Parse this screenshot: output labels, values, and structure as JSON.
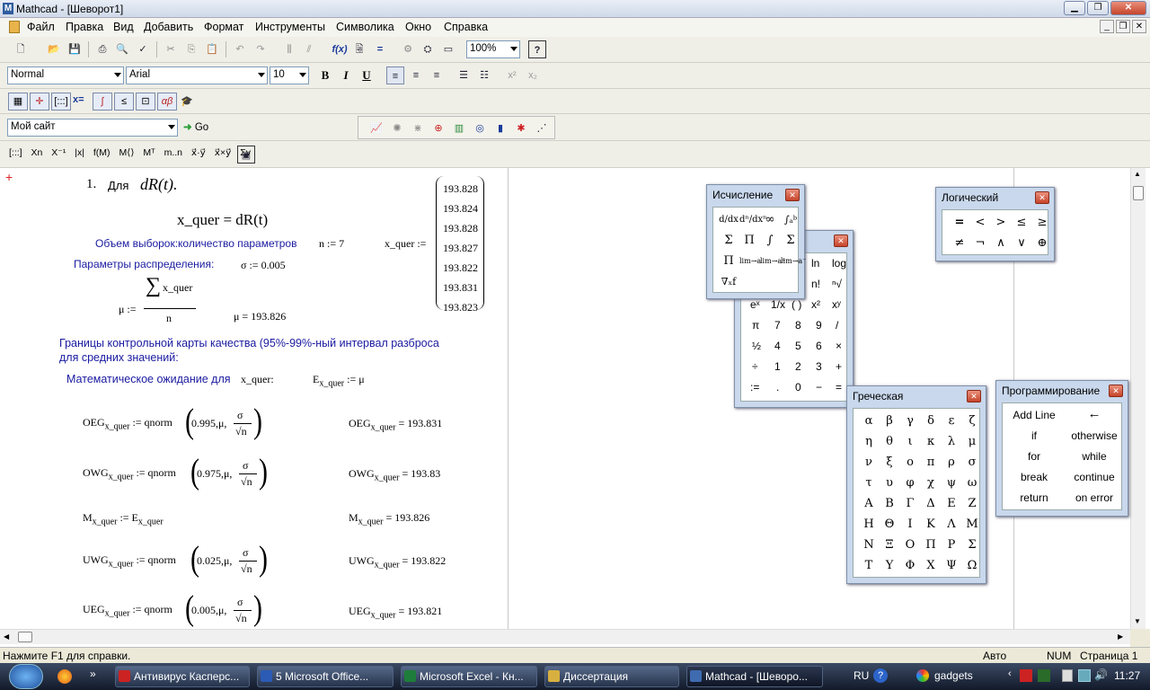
{
  "window": {
    "title": "Mathcad - [Шеворот1]"
  },
  "menu": [
    "Файл",
    "Правка",
    "Вид",
    "Добавить",
    "Формат",
    "Инструменты",
    "Символика",
    "Окно",
    "Справка"
  ],
  "toolbar": {
    "zoom": "100%",
    "style": "Normal",
    "font": "Arial",
    "size": "10",
    "bold": "B",
    "italic": "I",
    "underline": "U",
    "url": "Мой сайт",
    "go": "Go"
  },
  "math_toolbar": [
    "x=",
    "[:::]",
    "∫",
    "≤",
    "αβ"
  ],
  "matrix_toolbar": [
    "[:::]",
    "Xn",
    "X⁻¹",
    "|x|",
    "f(M)",
    "M⟨⟩",
    "Mᵀ",
    "m..n",
    "x⃗·y⃗",
    "x⃗×y⃗",
    "Σv"
  ],
  "doc": {
    "step": "1.",
    "step_word": "Для",
    "step_expr": "dR(t).",
    "xquer_def": "x_quer = dR(t)",
    "sample_label": "Объем выборок:количество параметров",
    "n_def": "n := 7",
    "xquer_assign": "x_quer :=",
    "xquer_values": [
      "193.828",
      "193.824",
      "193.828",
      "193.827",
      "193.822",
      "193.831",
      "193.823"
    ],
    "dist_label": "Параметры распределения:",
    "sigma_def": "σ := 0.005",
    "mu_lhs": "μ :=",
    "sum_sym": "∑",
    "sum_arg": "x_quer",
    "mu_den": "n",
    "mu_result": "μ = 193.826",
    "limits_line1": "Границы контрольной карты качества (95%-99%-ный интервал разброса",
    "limits_line2": "для средних значений:",
    "expect_label": "Математическое ожидание для",
    "expect_var": "x_quer:",
    "E_def": "E",
    "E_sub": "x_quer",
    "E_rhs": ":= μ",
    "rows": [
      {
        "name": "OEG",
        "sub": "x_quer",
        "fn": ":= qnorm",
        "p": "0.995",
        "res": "= 193.831"
      },
      {
        "name": "OWG",
        "sub": "x_quer",
        "fn": ":= qnorm",
        "p": "0.975",
        "res": "= 193.83"
      },
      {
        "name": "UWG",
        "sub": "x_quer",
        "fn": ":= qnorm",
        "p": "0.025",
        "res": "= 193.822"
      },
      {
        "name": "UEG",
        "sub": "x_quer",
        "fn": ":= qnorm",
        "p": "0.005",
        "res": "= 193.821"
      }
    ],
    "fn_mu": ",μ,",
    "fn_num": "σ",
    "fn_den": "√n",
    "M_name": "M",
    "M_sub": "x_quer",
    "M_rhs": ":= E",
    "M_rhs_sub": "x_quer",
    "M_res": "= 193.826"
  },
  "panels": {
    "calculus": {
      "title": "Исчисление",
      "items": [
        "d/dx",
        "dⁿ/dxⁿ",
        "∞",
        "∫ₐᵇ",
        "Σ",
        "Π",
        "∫",
        "Σ",
        "Π",
        "lim→a",
        "lim→a⁺",
        "lim→a⁻",
        "∇ₓf"
      ]
    },
    "calculator": {
      "items": [
        "ln",
        "log",
        "n!",
        "ⁿ√",
        "eˣ",
        "1/x",
        "( )",
        "x²",
        "xʸ",
        "π",
        "7",
        "8",
        "9",
        "/",
        "½",
        "4",
        "5",
        "6",
        "×",
        "÷",
        "1",
        "2",
        "3",
        "+",
        ":=",
        ".",
        "0",
        "−",
        "="
      ]
    },
    "logic": {
      "title": "Логический",
      "items": [
        "=",
        "<",
        ">",
        "≤",
        "≥",
        "≠",
        "¬",
        "∧",
        "∨",
        "⊕"
      ]
    },
    "greek": {
      "title": "Греческая",
      "items": [
        "α",
        "β",
        "γ",
        "δ",
        "ε",
        "ζ",
        "η",
        "θ",
        "ι",
        "κ",
        "λ",
        "μ",
        "ν",
        "ξ",
        "ο",
        "π",
        "ρ",
        "σ",
        "τ",
        "υ",
        "φ",
        "χ",
        "ψ",
        "ω",
        "Α",
        "Β",
        "Γ",
        "Δ",
        "Ε",
        "Ζ",
        "Η",
        "Θ",
        "Ι",
        "Κ",
        "Λ",
        "Μ",
        "Ν",
        "Ξ",
        "Ο",
        "Π",
        "Ρ",
        "Σ",
        "Τ",
        "Υ",
        "Φ",
        "Χ",
        "Ψ",
        "Ω"
      ]
    },
    "programming": {
      "title": "Программирование",
      "items": [
        "Add Line",
        "←",
        "if",
        "otherwise",
        "for",
        "while",
        "break",
        "continue",
        "return",
        "on error"
      ]
    }
  },
  "status": {
    "help": "Нажмите F1 для справки.",
    "auto": "Авто",
    "num": "NUM",
    "page": "Страница 1"
  },
  "taskbar": {
    "buttons": [
      "Антивирус Касперс...",
      "5 Microsoft Office...",
      "Microsoft Excel - Кн...",
      "Диссертация",
      "Mathcad - [Шеворо..."
    ],
    "lang": "RU",
    "gadgets": "gadgets",
    "clock": "11:27"
  }
}
